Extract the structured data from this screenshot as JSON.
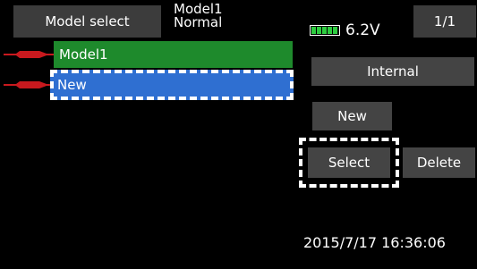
{
  "header": {
    "screen_title": "Model select",
    "current_model_name": "Model1",
    "current_model_mode": "Normal",
    "battery_voltage": "6.2V",
    "battery_level": 1.0,
    "page_indicator": "1/1"
  },
  "model_list": [
    {
      "name": "Model1",
      "color": "#1e8a2c"
    },
    {
      "name": "New",
      "color": "#2f6fd1"
    }
  ],
  "storage_button": "Internal",
  "actions": {
    "new_label": "New",
    "select_label": "Select",
    "delete_label": "Delete"
  },
  "datetime": "2015/7/17 16:36:06",
  "colors": {
    "heli_icon": "#c8191e",
    "selected_row": "#2f6fd1",
    "active_row": "#1e8a2c",
    "battery": "#2ecc40"
  }
}
